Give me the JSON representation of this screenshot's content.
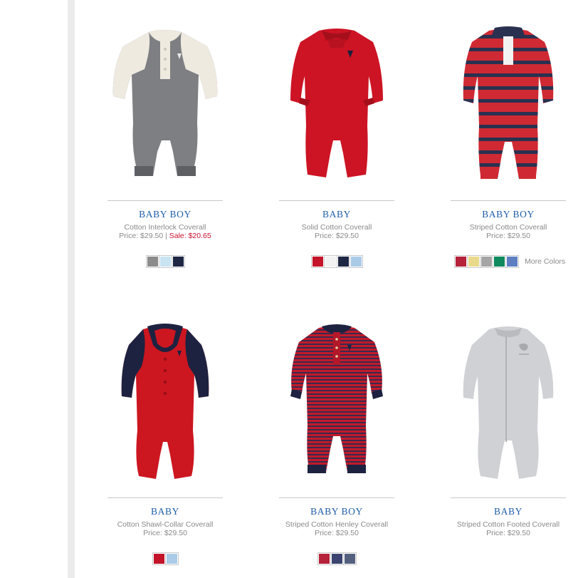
{
  "products": [
    {
      "category": "BABY BOY",
      "name": "Cotton Interlock Coverall",
      "price": "Price: $29.50",
      "sep": " | ",
      "sale": "Sale: $20.65",
      "swatches": [
        "#8b8b8b",
        "#c8e3f1",
        "#1e2744"
      ],
      "more": ""
    },
    {
      "category": "BABY",
      "name": "Solid Cotton Coverall",
      "price": "Price: $29.50",
      "sep": "",
      "sale": "",
      "swatches": [
        "#c4142a",
        "#f2f2f2",
        "#1e2744",
        "#a9cbe8"
      ],
      "more": ""
    },
    {
      "category": "BABY BOY",
      "name": "Striped Cotton Coverall",
      "price": "Price: $29.50",
      "sep": "",
      "sale": "",
      "swatches": [
        "#b5223a",
        "#e9d98a",
        "#a5a5a5",
        "#0f8a5f",
        "#5d7fc2"
      ],
      "more": "More Colors"
    },
    {
      "category": "BABY",
      "name": "Cotton Shawl-Collar Coverall",
      "price": "Price: $29.50",
      "sep": "",
      "sale": "",
      "swatches": [
        "#c4142a",
        "#a9cbe8"
      ],
      "more": ""
    },
    {
      "category": "BABY BOY",
      "name": "Striped Cotton Henley Coverall",
      "price": "Price: $29.50",
      "sep": "",
      "sale": "",
      "swatches": [
        "#b5223a",
        "#3b4470",
        "#55607f"
      ],
      "more": ""
    },
    {
      "category": "BABY",
      "name": "Striped Cotton Footed Coverall",
      "price": "Price: $29.50",
      "sep": "",
      "sale": "",
      "swatches": [],
      "more": ""
    }
  ]
}
